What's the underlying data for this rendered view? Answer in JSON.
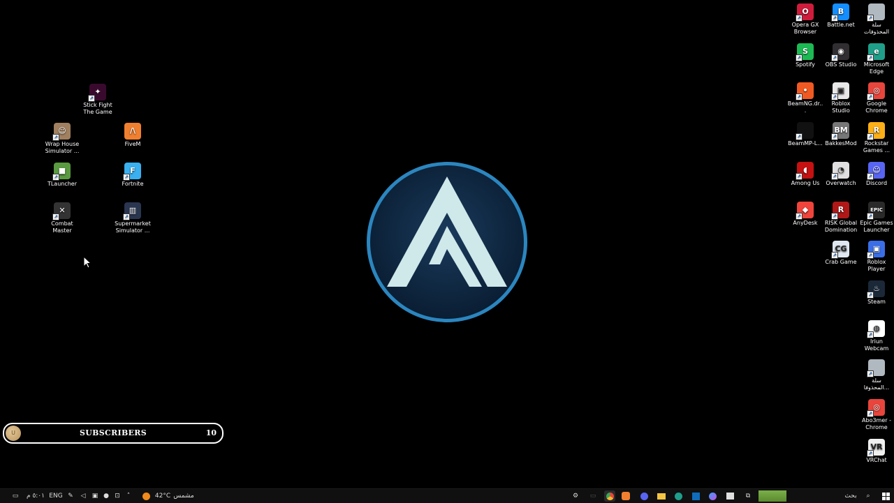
{
  "desktop": {
    "left_icons": [
      {
        "label": "Stick Fight The Game",
        "icon": "stick-fight-icon",
        "color": "#8a1f6a"
      },
      {
        "label": "Wrap House Simulator ...",
        "icon": "wrap-house-icon",
        "color": "#c8a080"
      },
      {
        "label": "FiveM",
        "icon": "fivem-icon",
        "color": "#f08030"
      },
      {
        "label": "TLauncher",
        "icon": "tlauncher-icon",
        "color": "#5a9a40"
      },
      {
        "label": "Fortnite",
        "icon": "fortnite-icon",
        "color": "#3ab0f0"
      },
      {
        "label": "Combat Master",
        "icon": "combat-master-icon",
        "color": "#444444"
      },
      {
        "label": "Supermarket Simulator ...",
        "icon": "supermarket-icon",
        "color": "#2a3550"
      }
    ],
    "right_icons": [
      {
        "label": "Opera GX Browser",
        "icon": "opera-gx-icon",
        "color": "#d01c3c",
        "letter": "O"
      },
      {
        "label": "Battle.net",
        "icon": "battlenet-icon",
        "color": "#148eff",
        "letter": "B"
      },
      {
        "label": "سلة المحذوفات",
        "icon": "recycle-bin-icon",
        "color": "#b0b8c0",
        "letter": ""
      },
      {
        "label": "Spotify",
        "icon": "spotify-icon",
        "color": "#1db954",
        "letter": "S"
      },
      {
        "label": "OBS Studio",
        "icon": "obs-icon",
        "color": "#302e31",
        "letter": "◉"
      },
      {
        "label": "Microsoft Edge",
        "icon": "edge-icon",
        "color": "#1f9f8a",
        "letter": "e"
      },
      {
        "label": "BeamNG.dr...",
        "icon": "beamng-icon",
        "color": "#f05a22",
        "letter": "•"
      },
      {
        "label": "Roblox Studio",
        "icon": "roblox-studio-icon",
        "color": "#e8e8e8",
        "letter": "▣"
      },
      {
        "label": "Google Chrome",
        "icon": "chrome-icon",
        "color": "#e8453c",
        "letter": "◎"
      },
      {
        "label": "BeamMP-L...",
        "icon": "beammp-icon",
        "color": "#111111",
        "letter": ""
      },
      {
        "label": "BakkesMod",
        "icon": "bakkesmod-icon",
        "color": "#777777",
        "letter": "BM"
      },
      {
        "label": "Rockstar Games ...",
        "icon": "rockstar-icon",
        "color": "#fcaf17",
        "letter": "R"
      },
      {
        "label": "Among Us",
        "icon": "among-us-icon",
        "color": "#c51111",
        "letter": "◖"
      },
      {
        "label": "Overwatch",
        "icon": "overwatch-icon",
        "color": "#e0e0e0",
        "letter": "◔"
      },
      {
        "label": "Discord",
        "icon": "discord-icon",
        "color": "#5865f2",
        "letter": "☺"
      },
      {
        "label": "AnyDesk",
        "icon": "anydesk-icon",
        "color": "#ef443b",
        "letter": "◆"
      },
      {
        "label": "RISK Global Domination",
        "icon": "risk-icon",
        "color": "#b01818",
        "letter": "R"
      },
      {
        "label": "Epic Games Launcher",
        "icon": "epic-games-icon",
        "color": "#2a2a2a",
        "letter": "EPIC"
      },
      {
        "label": "Crab Game",
        "icon": "crab-game-icon",
        "color": "#dfe8f0",
        "letter": "CG"
      },
      {
        "label": "Roblox Player",
        "icon": "roblox-player-icon",
        "color": "#3a6ee8",
        "letter": "▣"
      },
      {
        "label": "Steam",
        "icon": "steam-icon",
        "color": "#1b2838",
        "letter": "♨"
      },
      {
        "label": "Iriun Webcam",
        "icon": "iriun-icon",
        "color": "#ffffff",
        "letter": "◍"
      },
      {
        "label": "سلة المحذوفا...",
        "icon": "recycle-bin-2-icon",
        "color": "#b0b8c0",
        "letter": ""
      },
      {
        "label": "Abo3mer - Chrome",
        "icon": "chrome-profile-icon",
        "color": "#e8453c",
        "letter": "◎"
      },
      {
        "label": "VRChat",
        "icon": "vrchat-icon",
        "color": "#f0f0f0",
        "letter": "VR"
      }
    ]
  },
  "widget": {
    "label": "SUBSCRIBERS",
    "count": "10",
    "avatar_text": "U"
  },
  "taskbar": {
    "time": "٥:٠١ م",
    "language": "ENG",
    "weather_temp": "42°C",
    "weather_text": "مشمس",
    "search_label": "بحث",
    "apps": [
      "settings-app",
      "chrome-app",
      "fivem-app",
      "discord-app",
      "file-explorer-app",
      "edge-app",
      "outlook-app",
      "copilot-app",
      "store-app",
      "task-view",
      "minecraft-app"
    ]
  },
  "colors": {
    "logo_ring": "#3a9bd5",
    "logo_fill": "#0e2740",
    "logo_letter": "#cfe8ea"
  }
}
